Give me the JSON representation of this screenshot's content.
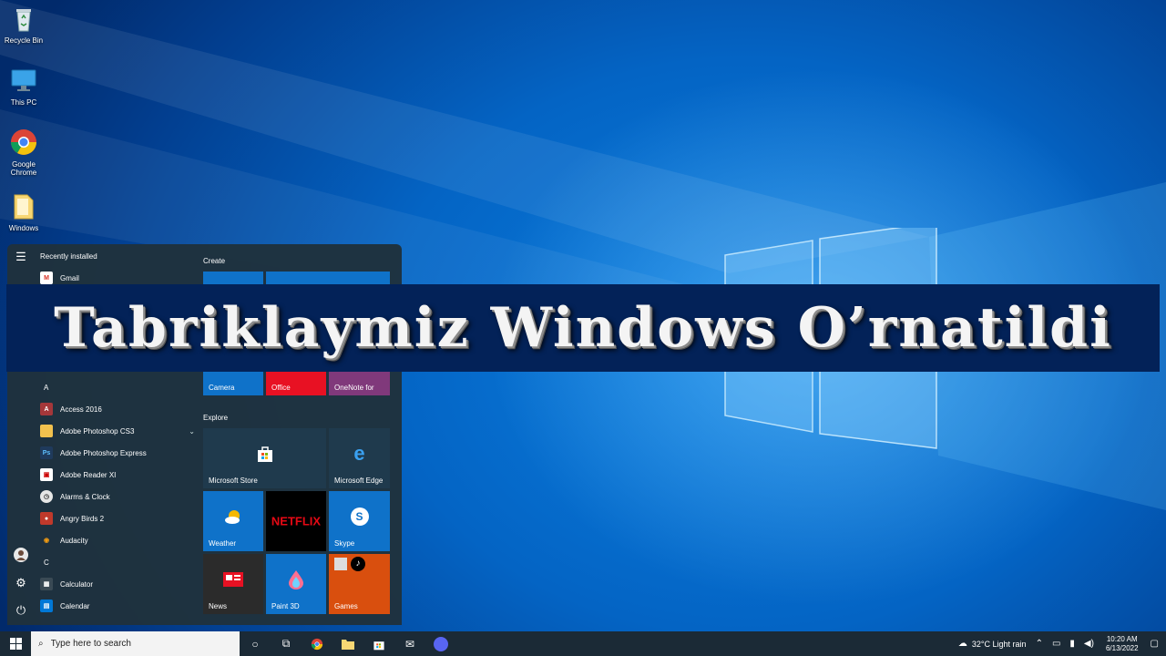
{
  "desktop": {
    "icons": [
      {
        "label": "Recycle Bin",
        "icon": "recycle-bin-icon"
      },
      {
        "label": "This PC",
        "icon": "monitor-icon"
      },
      {
        "label": "Google Chrome",
        "icon": "chrome-icon"
      },
      {
        "label": "Windows",
        "icon": "folder-icon"
      }
    ]
  },
  "banner": {
    "text": "Tabriklaymiz Windows O’rnatildi"
  },
  "start_menu": {
    "recently_installed": "Recently installed",
    "apps": [
      {
        "label": "Gmail",
        "icon": "gmail-icon",
        "color": "#ffffff"
      },
      {
        "label": "Access 2016",
        "icon": "access-icon",
        "color": "#a4373a"
      },
      {
        "label": "Adobe Photoshop CS3",
        "icon": "folder-icon",
        "color": "#f2c14e"
      },
      {
        "label": "Adobe Photoshop Express",
        "icon": "photoshop-express-icon",
        "color": "#1f3a5c"
      },
      {
        "label": "Adobe Reader XI",
        "icon": "adobe-reader-icon",
        "color": "#ffffff"
      },
      {
        "label": "Alarms & Clock",
        "icon": "alarm-clock-icon",
        "color": "#e6e6e6"
      },
      {
        "label": "Angry Birds 2",
        "icon": "angry-birds-icon",
        "color": "#c0392b"
      },
      {
        "label": "Audacity",
        "icon": "audacity-icon",
        "color": "#f39c12"
      },
      {
        "label": "Calculator",
        "icon": "calculator-icon",
        "color": "#3a4a55"
      },
      {
        "label": "Calendar",
        "icon": "calendar-icon",
        "color": "#0078d7"
      }
    ],
    "letters": {
      "a": "A",
      "c": "C"
    },
    "groups": {
      "create": "Create",
      "explore": "Explore"
    },
    "tiles": [
      {
        "label": "Camera",
        "icon": "camera-icon",
        "color": "#0f72c9"
      },
      {
        "label": "Office",
        "icon": "office-icon",
        "color": "#e81123"
      },
      {
        "label": "OneNote for",
        "icon": "onenote-icon",
        "color": "#80397b"
      },
      {
        "label": "Microsoft Store",
        "icon": "store-icon",
        "color": "#1f3a4d"
      },
      {
        "label": "Microsoft Edge",
        "icon": "edge-icon",
        "color": "#1f3a4d"
      },
      {
        "label": "Weather",
        "icon": "weather-icon",
        "color": "#0f72c9"
      },
      {
        "label": "NETFLIX",
        "icon": "netflix-icon",
        "color": "#000000"
      },
      {
        "label": "Skype",
        "icon": "skype-icon",
        "color": "#0f72c9"
      },
      {
        "label": "News",
        "icon": "news-icon",
        "color": "#2b2b2b"
      },
      {
        "label": "Paint 3D",
        "icon": "paint3d-icon",
        "color": "#0f72c9"
      },
      {
        "label": "Games",
        "icon": "games-icon",
        "color": "#d94f0e"
      }
    ]
  },
  "taskbar": {
    "search_placeholder": "Type here to search",
    "weather": "32°C  Light rain",
    "time": "10:20 AM",
    "date": "6/13/2022"
  }
}
